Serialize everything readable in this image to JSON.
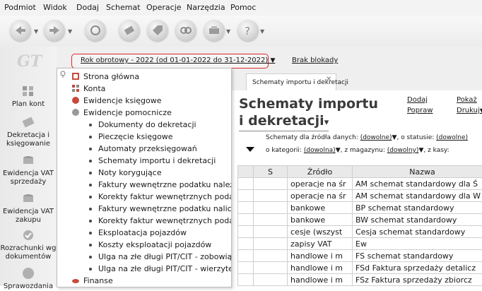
{
  "menu": [
    "Podmiot",
    "Widok",
    "Dodaj",
    "Schemat",
    "Operacje",
    "Narzędzia",
    "Pomoc"
  ],
  "sidebar": {
    "logo": "GT",
    "items": [
      {
        "label": "Plan kont",
        "icon": "plan-kont-icon"
      },
      {
        "label": "Dekretacja i księgowanie",
        "icon": "dekretacja-icon"
      },
      {
        "label": "Ewidencja VAT sprzedaży",
        "icon": "vat-sprzedazy-icon"
      },
      {
        "label": "Ewidencja VAT zakupu",
        "icon": "vat-zakupu-icon"
      },
      {
        "label": "Rozrachunki wg dokumentów",
        "icon": "rozrachunki-icon"
      },
      {
        "label": "Sprawozdania",
        "icon": "sprawozdania-icon"
      }
    ]
  },
  "header": {
    "rok": "Rok obrotowy - 2022  (od 01-01-2022 do 31-12-2022)",
    "blokada": "Brak blokady"
  },
  "dropdown": {
    "items": [
      {
        "label": "Strona główna",
        "level": 0,
        "icon": "home-icon"
      },
      {
        "label": "Konta",
        "level": 0,
        "icon": "konta-icon"
      },
      {
        "label": "Ewidencje księgowe",
        "level": 0,
        "icon": "ewidencje-icon"
      },
      {
        "label": "Ewidencje pomocnicze",
        "level": 0,
        "icon": "ewidencje-pomocnicze-icon"
      },
      {
        "label": "Dokumenty do dekretacji",
        "level": 1
      },
      {
        "label": "Pieczęcie księgowe",
        "level": 1
      },
      {
        "label": "Automaty przeksięgowań",
        "level": 1
      },
      {
        "label": "Schematy importu i dekretacji",
        "level": 1
      },
      {
        "label": "Noty korygujące",
        "level": 1
      },
      {
        "label": "Faktury wewnętrzne podatku należne",
        "level": 1
      },
      {
        "label": "Korekty faktur wewnętrznych podatk",
        "level": 1
      },
      {
        "label": "Faktury wewnętrzne podatku naliczor",
        "level": 1
      },
      {
        "label": "Korekty faktur wewnętrznych podatk",
        "level": 1
      },
      {
        "label": "Eksploatacja pojazdów",
        "level": 1
      },
      {
        "label": "Koszty eksploatacji pojazdów",
        "level": 1
      },
      {
        "label": "Ulga na złe długi PIT/CIT - zobowiąza",
        "level": 1
      },
      {
        "label": "Ulga na złe długi PIT/CIT - wierzytelnc",
        "level": 1
      },
      {
        "label": "Finanse",
        "level": 0,
        "icon": "finanse-icon"
      }
    ]
  },
  "tab": {
    "label": "Schematy importu i dekretacji"
  },
  "content": {
    "title_line1": "Schematy importu",
    "title_line2": "i dekretacji",
    "title_arrow": "▾",
    "actions": {
      "dodaj": "Dodaj",
      "popraw": "Popraw",
      "pokaz": "Pokaż",
      "drukuj": "Drukuj"
    },
    "filter1": {
      "prefix": "Schematy dla źródła danych:",
      "value1": "(dowolne)",
      "mid": ", o statusie:",
      "value2": "(dowolne)"
    },
    "filter2": {
      "prefix": "o kategorii:",
      "value1": "(dowolna)",
      "mid1": ", z magazynu:",
      "value2": "(dowolny)",
      "mid2": ", z kasy:"
    }
  },
  "table": {
    "headers": [
      "",
      "S",
      "Źródło",
      "Nazwa"
    ],
    "rows": [
      {
        "zrodlo": "operacje na śr",
        "nazwa": "AM schemat standardowy dla Ś"
      },
      {
        "zrodlo": "operacje na śr",
        "nazwa": "AM schemat standardowy dla W"
      },
      {
        "zrodlo": "bankowe",
        "nazwa": "BP schemat standardowy"
      },
      {
        "zrodlo": "bankowe",
        "nazwa": "BW schemat standardowy"
      },
      {
        "zrodlo": "cesje (wszyst",
        "nazwa": "Cesja schemat standardowy"
      },
      {
        "zrodlo": "zapisy VAT",
        "nazwa": "Ew"
      },
      {
        "zrodlo": "handlowe i m",
        "nazwa": "FS schemat standardowy"
      },
      {
        "zrodlo": "handlowe i m",
        "nazwa": "FSd Faktura sprzedaży detalicz"
      },
      {
        "zrodlo": "handlowe i m",
        "nazwa": "FSz Faktura sprzedaży zbiorcz"
      }
    ]
  }
}
